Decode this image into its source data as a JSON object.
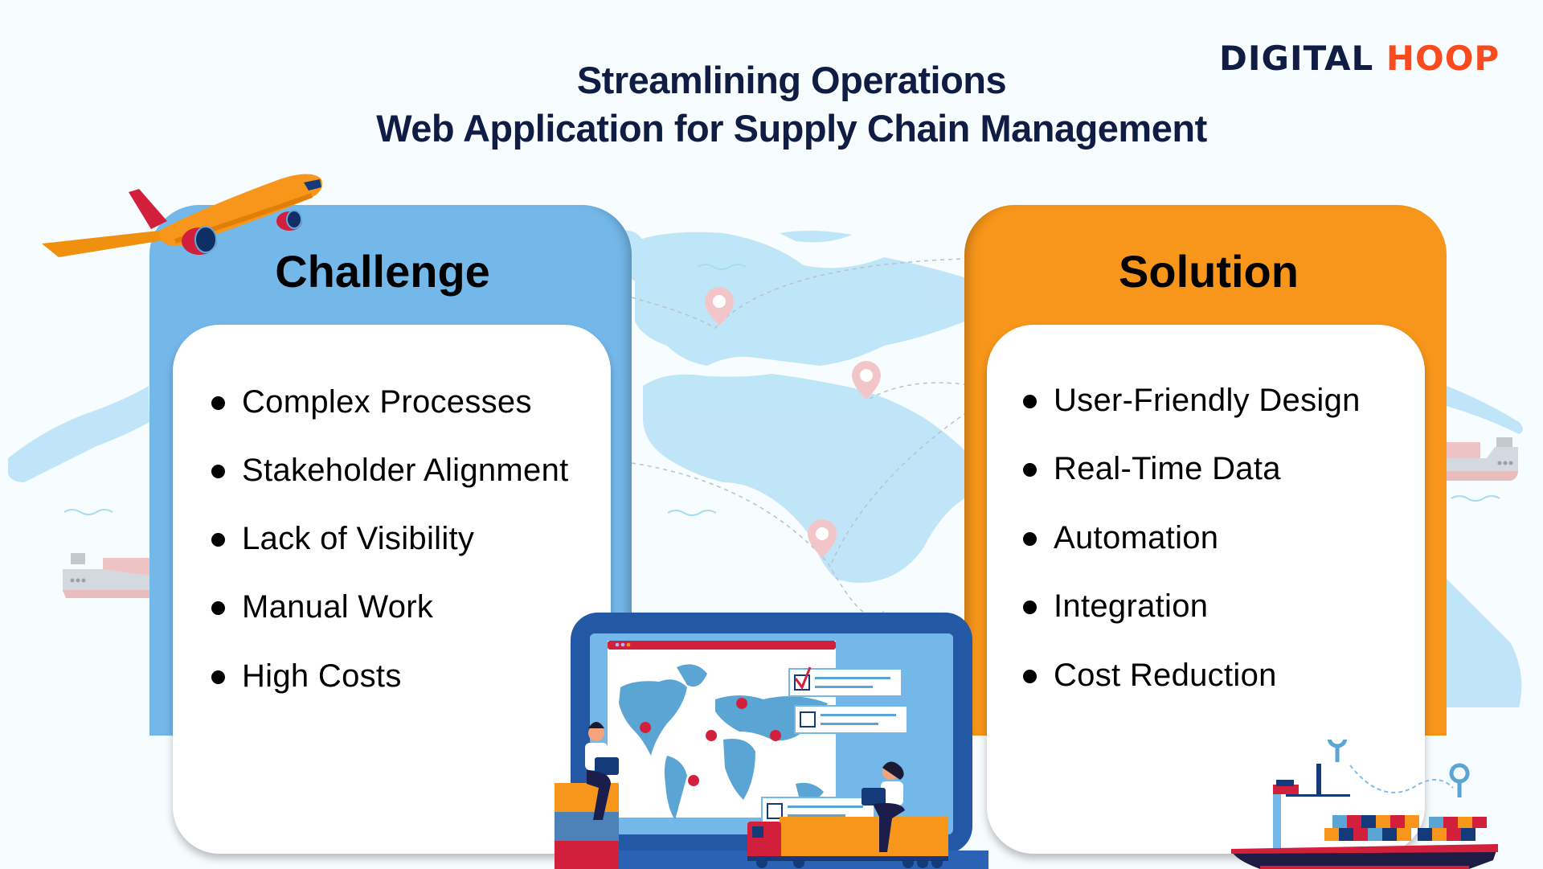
{
  "header": {
    "title_line1": "Streamlining Operations",
    "title_line2": "Web Application for Supply Chain Management"
  },
  "logo": {
    "part1": "DIGITAL",
    "part2": "HOOP",
    "colors": {
      "primary": "#0f1d45",
      "accent": "#fa4b1e"
    }
  },
  "challenge": {
    "title": "Challenge",
    "color": "#74b8ea",
    "items": [
      {
        "label": "Complex Processes"
      },
      {
        "label": "Stakeholder Alignment"
      },
      {
        "label": "Lack of Visibility"
      },
      {
        "label": "Manual Work"
      },
      {
        "label": "High Costs"
      }
    ]
  },
  "solution": {
    "title": "Solution",
    "color": "#f7961a",
    "items": [
      {
        "label": "User-Friendly Design"
      },
      {
        "label": "Real-Time Data"
      },
      {
        "label": "Automation"
      },
      {
        "label": "Integration"
      },
      {
        "label": "Cost Reduction"
      }
    ]
  },
  "illustrations": {
    "airplane": "airplane-icon",
    "laptop_map": "laptop-world-map-illustration",
    "cargo_ship": "cargo-ship-icon",
    "truck": "container-truck-icon",
    "location_pins": "map-pin-icon"
  }
}
